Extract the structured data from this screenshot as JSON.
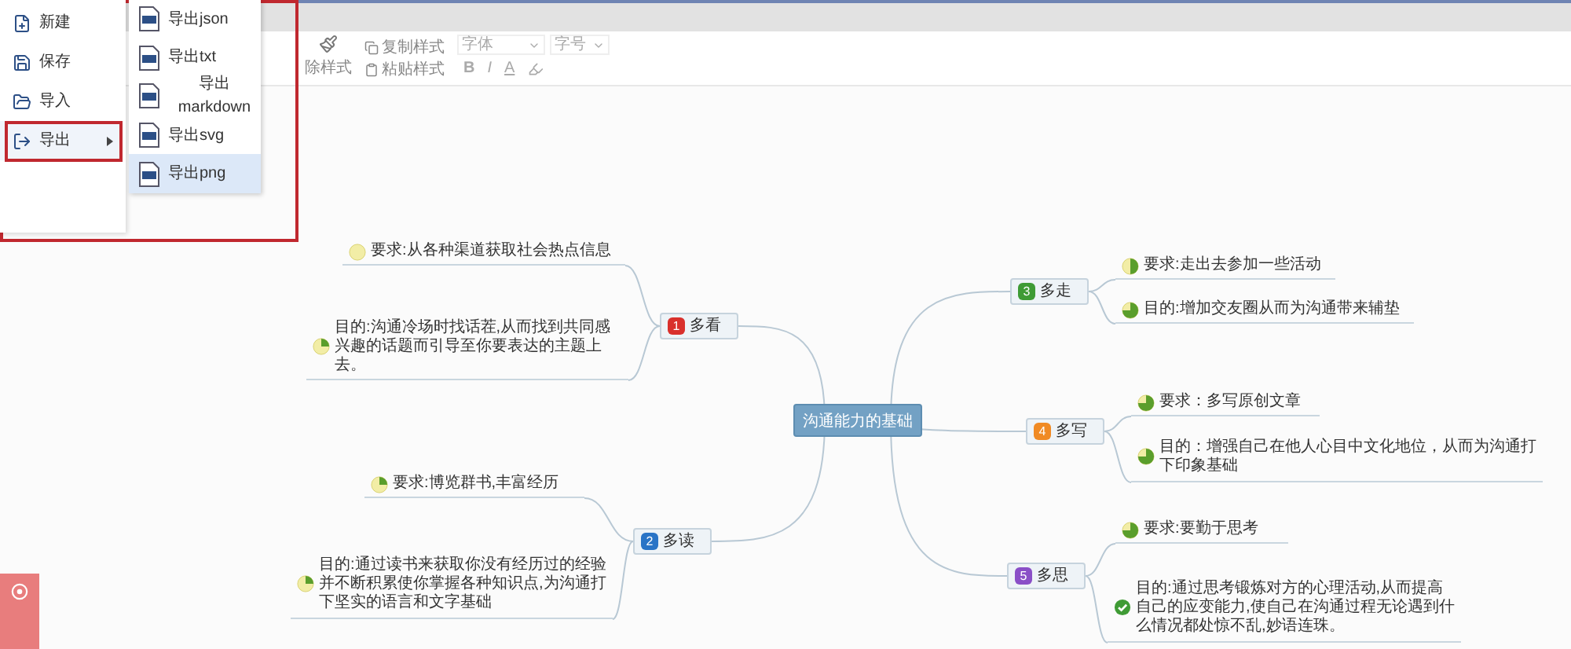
{
  "file_menu": {
    "items": [
      {
        "label": "新建",
        "kind": "new",
        "selected": false,
        "submenu": false
      },
      {
        "label": "保存",
        "kind": "save",
        "selected": false,
        "submenu": false
      },
      {
        "label": "导入",
        "kind": "open",
        "selected": false,
        "submenu": false
      },
      {
        "label": "导出",
        "kind": "export",
        "selected": true,
        "submenu": true
      }
    ],
    "submenu": [
      {
        "label": "导出json",
        "selected": false
      },
      {
        "label": "导出txt",
        "selected": false
      },
      {
        "label": "导出markdown",
        "selected": false
      },
      {
        "label": "导出svg",
        "selected": false
      },
      {
        "label": "导出png",
        "selected": true
      }
    ]
  },
  "toolbar": {
    "clear_style": "除样式",
    "copy_style": "复制样式",
    "paste_style": "粘贴样式",
    "font_family": "字体",
    "font_size": "字号",
    "bold": "B",
    "italic": "I",
    "font_color": "A"
  },
  "mindmap": {
    "root": "沟通能力的基础",
    "branches": [
      {
        "label": "多看",
        "priority": "1",
        "color": "#d9302c",
        "children": [
          {
            "text": "要求:从各种渠道获取社会热点信息",
            "kind": "empty"
          },
          {
            "text": "目的:沟通冷场时找话茬,从而找到共同感兴趣的话题而引导至你要表达的主题上去。",
            "kind": "quarter"
          }
        ]
      },
      {
        "label": "多读",
        "priority": "2",
        "color": "#2a74c6",
        "children": [
          {
            "text": "要求:博览群书,丰富经历",
            "kind": "quarter"
          },
          {
            "text": "目的:通过读书来获取你没有经历过的经验并不断积累使你掌握各种知识点,为沟通打下坚实的语言和文字基础",
            "kind": "quarter"
          }
        ]
      },
      {
        "label": "多走",
        "priority": "3",
        "color": "#3f9b35",
        "children": [
          {
            "text": "要求:走出去参加一些活动",
            "kind": "half"
          },
          {
            "text": "目的:增加交友圈从而为沟通带来辅垫",
            "kind": "threequarter"
          }
        ]
      },
      {
        "label": "多写",
        "priority": "4",
        "color": "#f08a24",
        "children": [
          {
            "text": "要求：多写原创文章",
            "kind": "threequarter"
          },
          {
            "text": "目的：增强自己在他人心目中文化地位，从而为沟通打下印象基础",
            "kind": "threequarter"
          }
        ]
      },
      {
        "label": "多思",
        "priority": "5",
        "color": "#8a4fc7",
        "children": [
          {
            "text": "要求:要勤于思考",
            "kind": "threequarter"
          },
          {
            "text": "目的:通过思考锻炼对方的心理活动,从而提高自己的应变能力,使自己在沟通过程无论遇到什么情况都处惊不乱,妙语连珠。",
            "kind": "done"
          }
        ]
      }
    ]
  }
}
